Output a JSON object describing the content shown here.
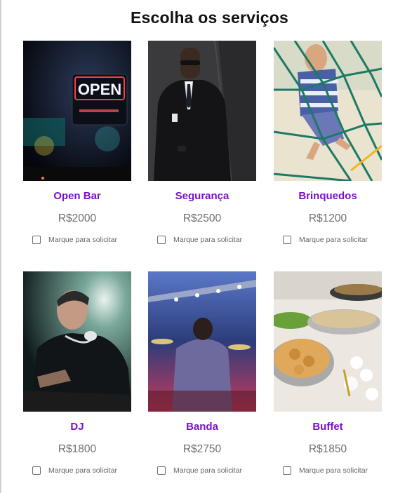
{
  "page": {
    "title": "Escolha os serviços"
  },
  "checkbox_label": "Marque para solicitar",
  "colors": {
    "accent": "#7a10c8",
    "price": "#6f6f6f"
  },
  "services": [
    {
      "name": "Open Bar",
      "price": "R$2000",
      "photo": "open-neon-sign-photo",
      "photo_text": "OPEN",
      "checked": false
    },
    {
      "name": "Segurança",
      "price": "R$2500",
      "photo": "security-guard-photo",
      "checked": false
    },
    {
      "name": "Brinquedos",
      "price": "R$1200",
      "photo": "kid-climbing-net-photo",
      "checked": false
    },
    {
      "name": "DJ",
      "price": "R$1800",
      "photo": "dj-headphones-photo",
      "checked": false
    },
    {
      "name": "Banda",
      "price": "R$2750",
      "photo": "band-drummer-stage-photo",
      "checked": false
    },
    {
      "name": "Buffet",
      "price": "R$1850",
      "photo": "buffet-food-trays-photo",
      "checked": false
    }
  ]
}
